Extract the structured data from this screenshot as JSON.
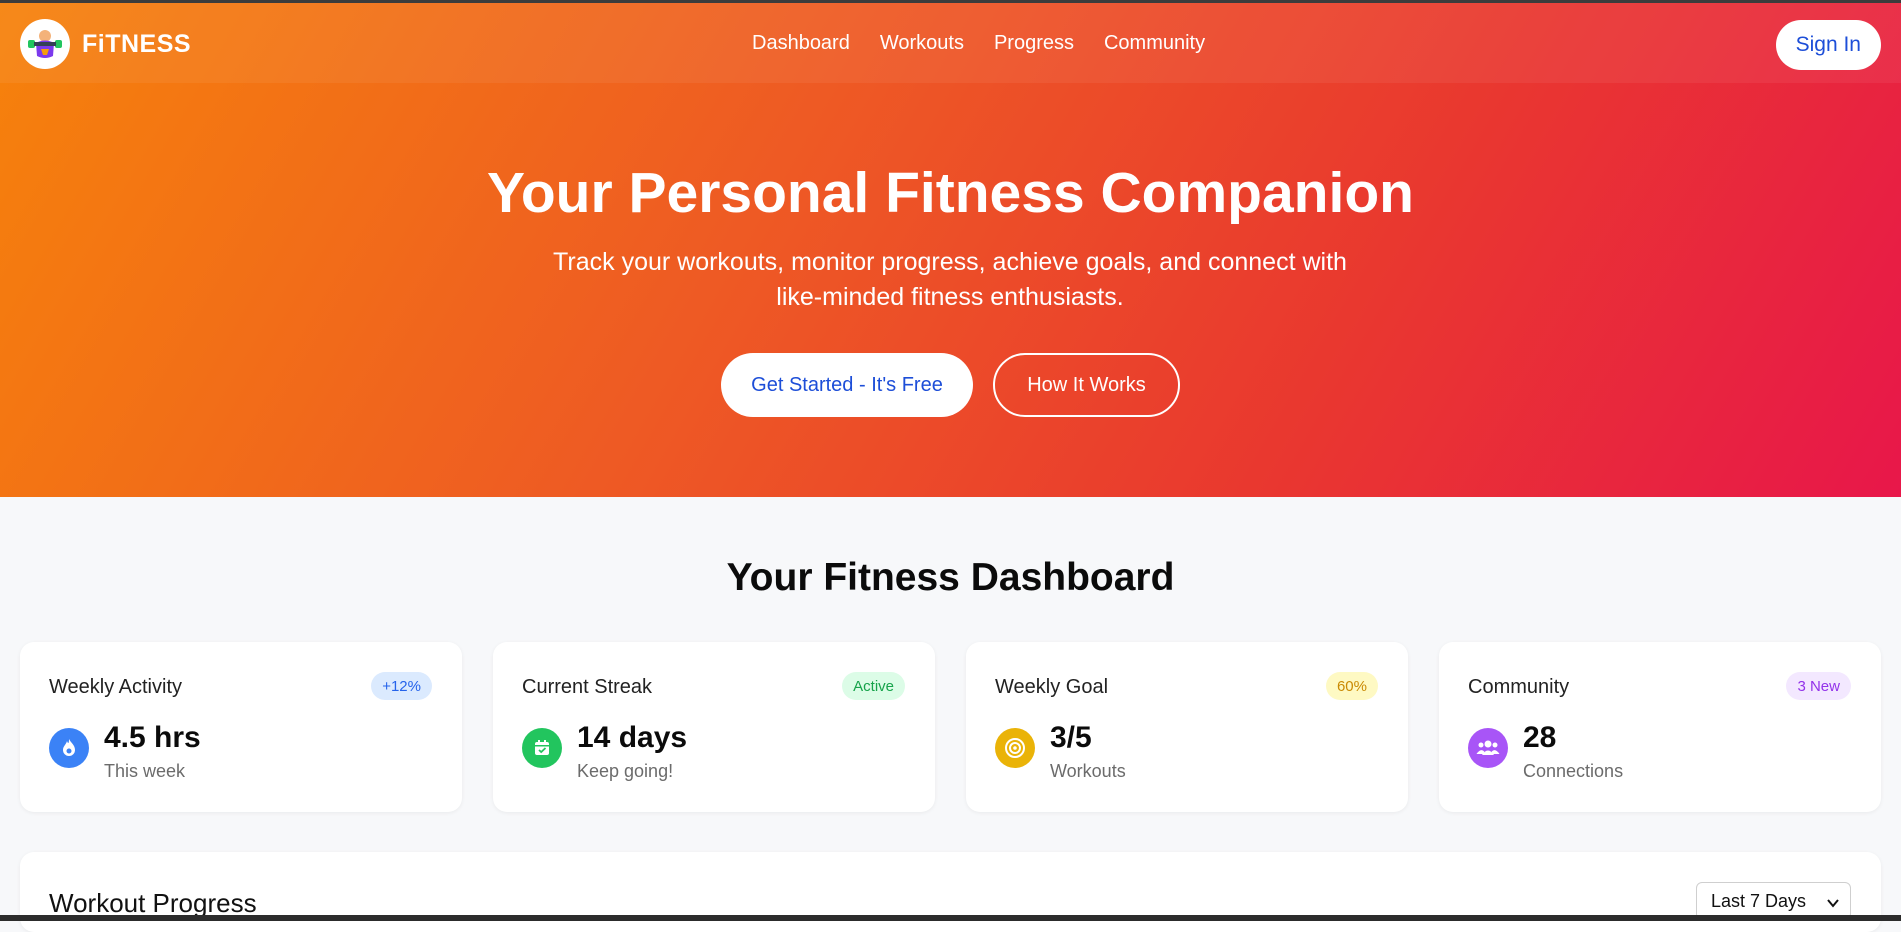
{
  "brand": {
    "name": "FiTNESS"
  },
  "nav": {
    "links": [
      "Dashboard",
      "Workouts",
      "Progress",
      "Community"
    ],
    "signin_label": "Sign In"
  },
  "hero": {
    "title": "Your Personal Fitness Companion",
    "subtitle": "Track your workouts, monitor progress, achieve goals, and connect with like-minded fitness enthusiasts.",
    "primary_cta": "Get Started - It's Free",
    "secondary_cta": "How It Works"
  },
  "dashboard": {
    "title": "Your Fitness Dashboard",
    "cards": [
      {
        "label": "Weekly Activity",
        "badge": "+12%",
        "value": "4.5 hrs",
        "sub": "This week",
        "icon": "flame-icon",
        "color": "#3b82f6"
      },
      {
        "label": "Current Streak",
        "badge": "Active",
        "value": "14 days",
        "sub": "Keep going!",
        "icon": "calendar-check-icon",
        "color": "#22c55e"
      },
      {
        "label": "Weekly Goal",
        "badge": "60%",
        "value": "3/5",
        "sub": "Workouts",
        "icon": "target-icon",
        "color": "#eab308"
      },
      {
        "label": "Community",
        "badge": "3 New",
        "value": "28",
        "sub": "Connections",
        "icon": "users-icon",
        "color": "#a855f7"
      }
    ]
  },
  "progress": {
    "title": "Workout Progress",
    "range_selected": "Last 7 Days"
  },
  "colors": {
    "hero_gradient_start": "#f6820b",
    "hero_gradient_end": "#e8174a",
    "accent_blue": "#1d4ed8"
  }
}
